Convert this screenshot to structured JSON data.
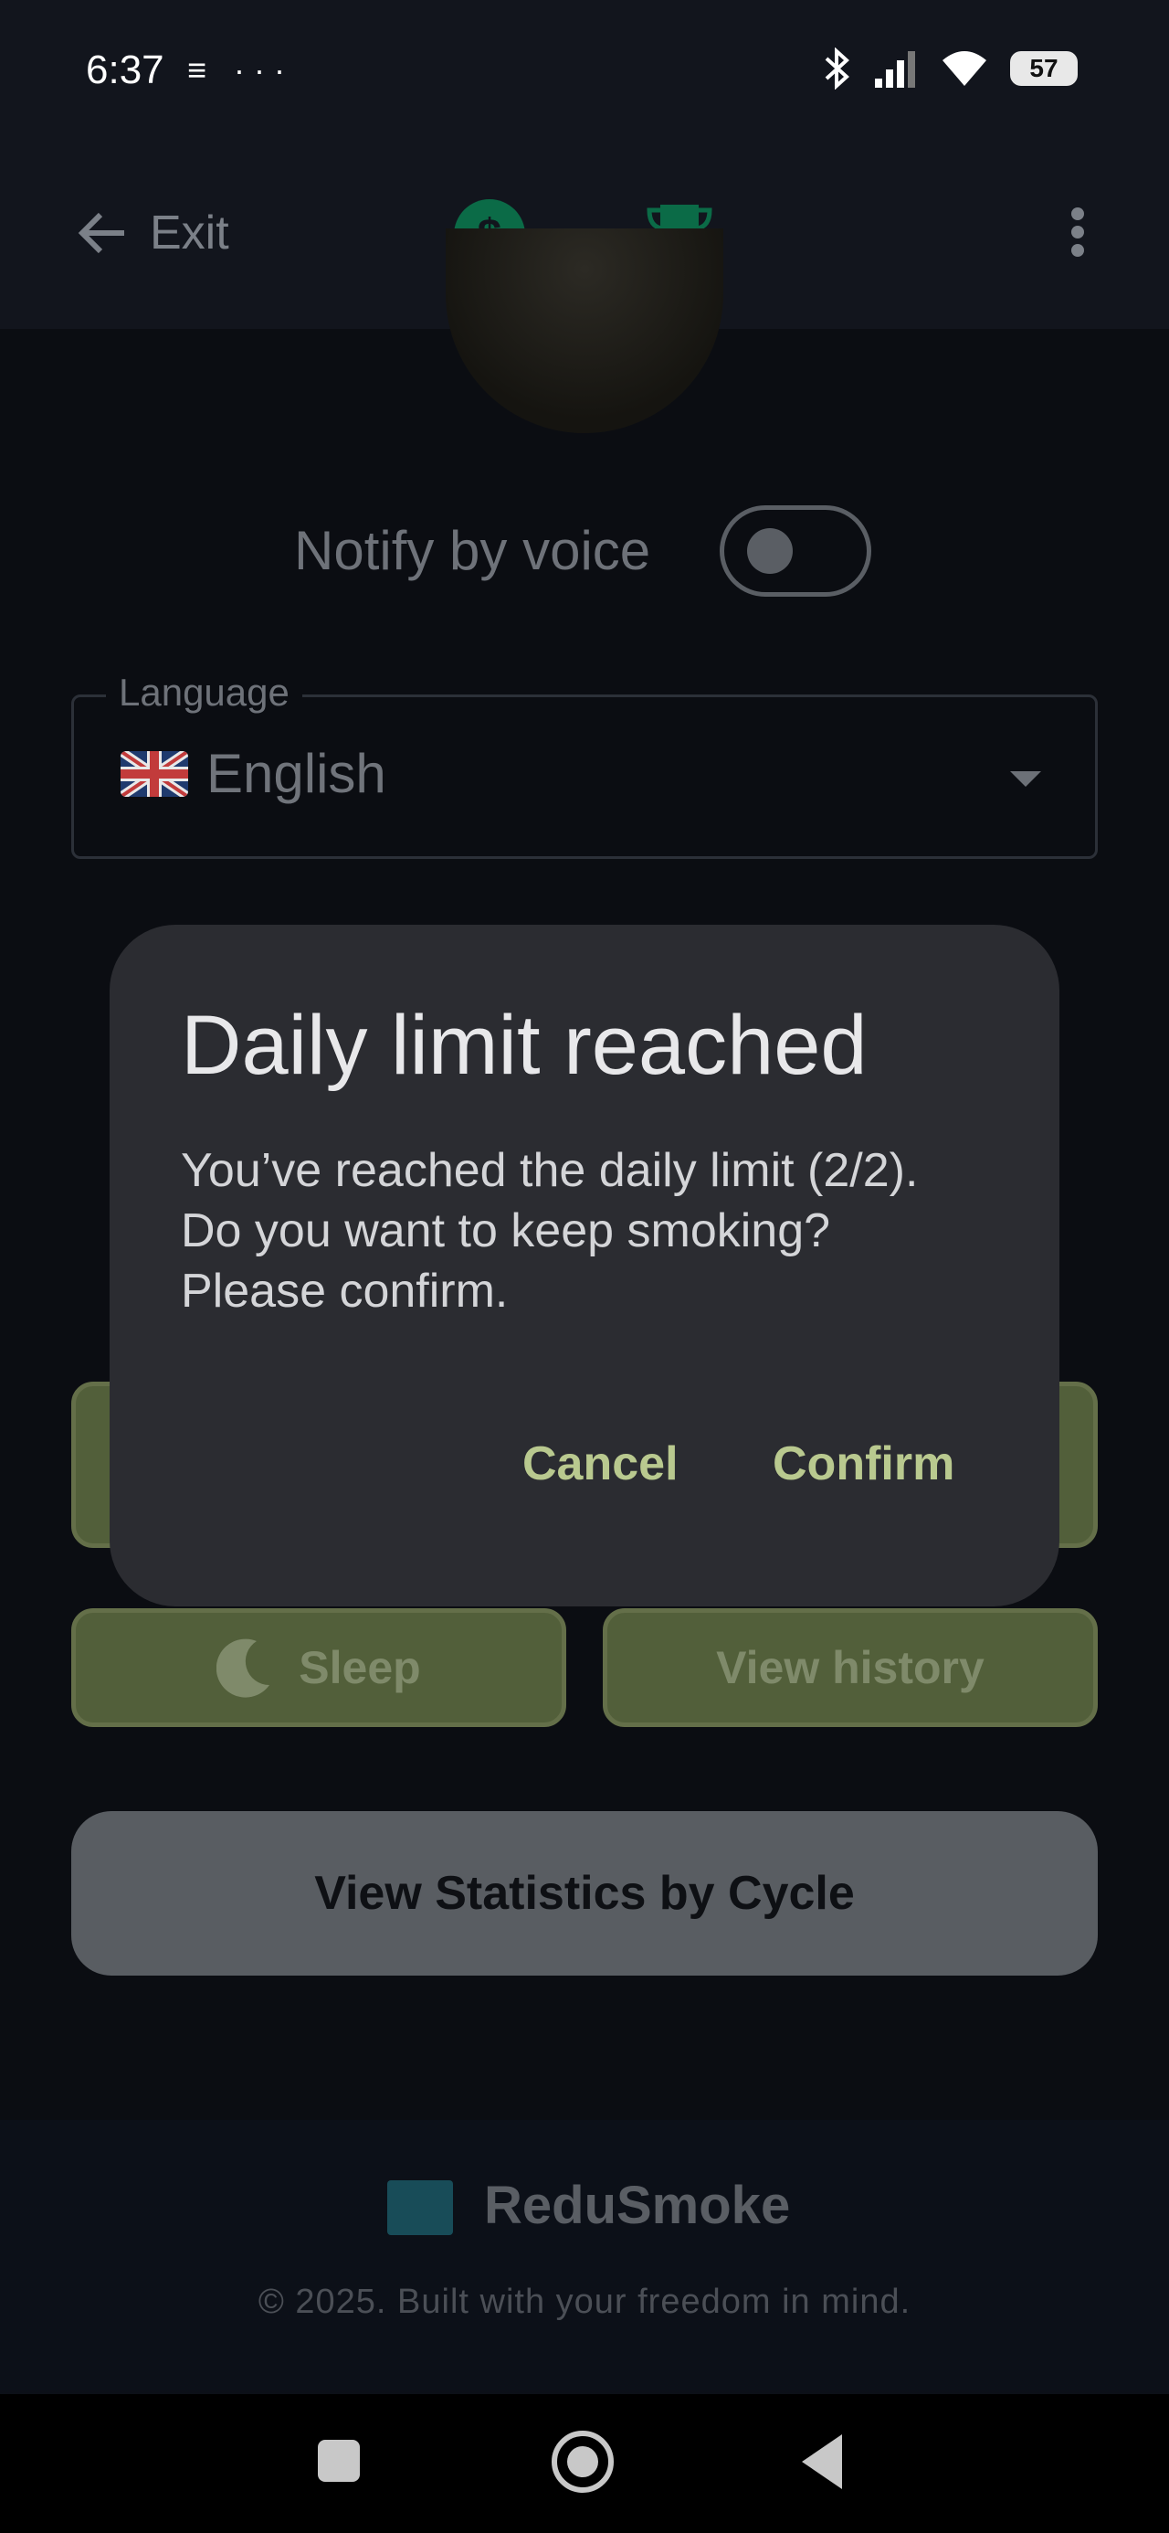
{
  "status_bar": {
    "time": "6:37",
    "notif_icons": "≡ ···",
    "battery": "57"
  },
  "app_bar": {
    "exit_label": "Exit",
    "icons": [
      "back-arrow-icon",
      "dollar-icon",
      "trophy-icon",
      "more-vertical-icon"
    ],
    "accent_color": "#0b6b47"
  },
  "settings": {
    "notify_voice_label": "Notify by voice",
    "notify_voice_on": false,
    "language_label": "Language",
    "language_value": "English",
    "language_flag": "uk-flag-icon"
  },
  "buttons": {
    "sleep_label": "Sleep",
    "history_label": "View history",
    "stats_label": "View Statistics by Cycle"
  },
  "footer": {
    "brand": "ReduSmoke",
    "copyright": "© 2025. Built with your freedom in mind."
  },
  "dialog": {
    "title": "Daily limit reached",
    "body_line1": "You’ve reached the daily limit (2/2).",
    "body_line2": "Do you want to keep smoking?",
    "body_line3": "Please confirm.",
    "cancel_label": "Cancel",
    "confirm_label": "Confirm",
    "button_color": "#b9c98f"
  }
}
